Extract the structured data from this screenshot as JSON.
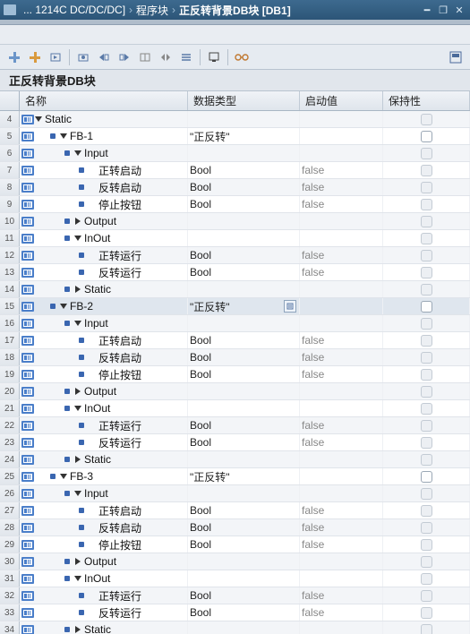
{
  "titlebar": {
    "crumb1": "... 1214C DC/DC/DC]",
    "crumb2": "程序块",
    "crumb3": "正反转背景DB块 [DB1]",
    "sep": "›"
  },
  "block_title": "正反转背景DB块",
  "columns": {
    "name": "名称",
    "type": "数据类型",
    "start": "启动值",
    "retain": "保持性"
  },
  "rows": [
    {
      "n": 4,
      "depth": 0,
      "expand": true,
      "bullet": false,
      "tag": true,
      "name": "Static",
      "type": "",
      "start": "",
      "ret": "dis"
    },
    {
      "n": 5,
      "depth": 1,
      "expand": true,
      "bullet": true,
      "tag": true,
      "name": "FB-1",
      "type": "\"正反转\"",
      "start": "",
      "ret": "en"
    },
    {
      "n": 6,
      "depth": 2,
      "expand": true,
      "bullet": true,
      "tag": true,
      "name": "Input",
      "type": "",
      "start": "",
      "ret": "dis"
    },
    {
      "n": 7,
      "depth": 3,
      "expand": false,
      "bullet": true,
      "tag": true,
      "name": "正转启动",
      "type": "Bool",
      "start": "false",
      "ret": "dis"
    },
    {
      "n": 8,
      "depth": 3,
      "expand": false,
      "bullet": true,
      "tag": true,
      "name": "反转启动",
      "type": "Bool",
      "start": "false",
      "ret": "dis"
    },
    {
      "n": 9,
      "depth": 3,
      "expand": false,
      "bullet": true,
      "tag": true,
      "name": "停止按钮",
      "type": "Bool",
      "start": "false",
      "ret": "dis"
    },
    {
      "n": 10,
      "depth": 2,
      "expand": false,
      "bullet": true,
      "tag": true,
      "name": "Output",
      "type": "",
      "start": "",
      "ret": "dis"
    },
    {
      "n": 11,
      "depth": 2,
      "expand": true,
      "bullet": true,
      "tag": true,
      "name": "InOut",
      "type": "",
      "start": "",
      "ret": "dis"
    },
    {
      "n": 12,
      "depth": 3,
      "expand": false,
      "bullet": true,
      "tag": true,
      "name": "正转运行",
      "type": "Bool",
      "start": "false",
      "ret": "dis"
    },
    {
      "n": 13,
      "depth": 3,
      "expand": false,
      "bullet": true,
      "tag": true,
      "name": "反转运行",
      "type": "Bool",
      "start": "false",
      "ret": "dis"
    },
    {
      "n": 14,
      "depth": 2,
      "expand": false,
      "bullet": true,
      "tag": true,
      "name": "Static",
      "type": "",
      "start": "",
      "ret": "dis"
    },
    {
      "n": 15,
      "depth": 1,
      "expand": true,
      "bullet": true,
      "tag": true,
      "name": "FB-2",
      "type": "\"正反转\"",
      "start": "",
      "ret": "en",
      "sel": true,
      "dd": true
    },
    {
      "n": 16,
      "depth": 2,
      "expand": true,
      "bullet": true,
      "tag": true,
      "name": "Input",
      "type": "",
      "start": "",
      "ret": "dis"
    },
    {
      "n": 17,
      "depth": 3,
      "expand": false,
      "bullet": true,
      "tag": true,
      "name": "正转启动",
      "type": "Bool",
      "start": "false",
      "ret": "dis"
    },
    {
      "n": 18,
      "depth": 3,
      "expand": false,
      "bullet": true,
      "tag": true,
      "name": "反转启动",
      "type": "Bool",
      "start": "false",
      "ret": "dis"
    },
    {
      "n": 19,
      "depth": 3,
      "expand": false,
      "bullet": true,
      "tag": true,
      "name": "停止按钮",
      "type": "Bool",
      "start": "false",
      "ret": "dis"
    },
    {
      "n": 20,
      "depth": 2,
      "expand": false,
      "bullet": true,
      "tag": true,
      "name": "Output",
      "type": "",
      "start": "",
      "ret": "dis"
    },
    {
      "n": 21,
      "depth": 2,
      "expand": true,
      "bullet": true,
      "tag": true,
      "name": "InOut",
      "type": "",
      "start": "",
      "ret": "dis"
    },
    {
      "n": 22,
      "depth": 3,
      "expand": false,
      "bullet": true,
      "tag": true,
      "name": "正转运行",
      "type": "Bool",
      "start": "false",
      "ret": "dis"
    },
    {
      "n": 23,
      "depth": 3,
      "expand": false,
      "bullet": true,
      "tag": true,
      "name": "反转运行",
      "type": "Bool",
      "start": "false",
      "ret": "dis"
    },
    {
      "n": 24,
      "depth": 2,
      "expand": false,
      "bullet": true,
      "tag": true,
      "name": "Static",
      "type": "",
      "start": "",
      "ret": "dis"
    },
    {
      "n": 25,
      "depth": 1,
      "expand": true,
      "bullet": true,
      "tag": true,
      "name": "FB-3",
      "type": "\"正反转\"",
      "start": "",
      "ret": "en"
    },
    {
      "n": 26,
      "depth": 2,
      "expand": true,
      "bullet": true,
      "tag": true,
      "name": "Input",
      "type": "",
      "start": "",
      "ret": "dis"
    },
    {
      "n": 27,
      "depth": 3,
      "expand": false,
      "bullet": true,
      "tag": true,
      "name": "正转启动",
      "type": "Bool",
      "start": "false",
      "ret": "dis"
    },
    {
      "n": 28,
      "depth": 3,
      "expand": false,
      "bullet": true,
      "tag": true,
      "name": "反转启动",
      "type": "Bool",
      "start": "false",
      "ret": "dis"
    },
    {
      "n": 29,
      "depth": 3,
      "expand": false,
      "bullet": true,
      "tag": true,
      "name": "停止按钮",
      "type": "Bool",
      "start": "false",
      "ret": "dis"
    },
    {
      "n": 30,
      "depth": 2,
      "expand": false,
      "bullet": true,
      "tag": true,
      "name": "Output",
      "type": "",
      "start": "",
      "ret": "dis"
    },
    {
      "n": 31,
      "depth": 2,
      "expand": true,
      "bullet": true,
      "tag": true,
      "name": "InOut",
      "type": "",
      "start": "",
      "ret": "dis"
    },
    {
      "n": 32,
      "depth": 3,
      "expand": false,
      "bullet": true,
      "tag": true,
      "name": "正转运行",
      "type": "Bool",
      "start": "false",
      "ret": "dis"
    },
    {
      "n": 33,
      "depth": 3,
      "expand": false,
      "bullet": true,
      "tag": true,
      "name": "反转运行",
      "type": "Bool",
      "start": "false",
      "ret": "dis"
    },
    {
      "n": 34,
      "depth": 2,
      "expand": false,
      "bullet": true,
      "tag": true,
      "name": "Static",
      "type": "",
      "start": "",
      "ret": "dis"
    }
  ],
  "toolbar_icons": [
    "insert-row",
    "add-row",
    "load-start",
    "snapshot",
    "copy-snap",
    "restore-snap",
    "load-retain",
    "init-retain",
    "expand-all",
    "monitor",
    "glasses"
  ]
}
